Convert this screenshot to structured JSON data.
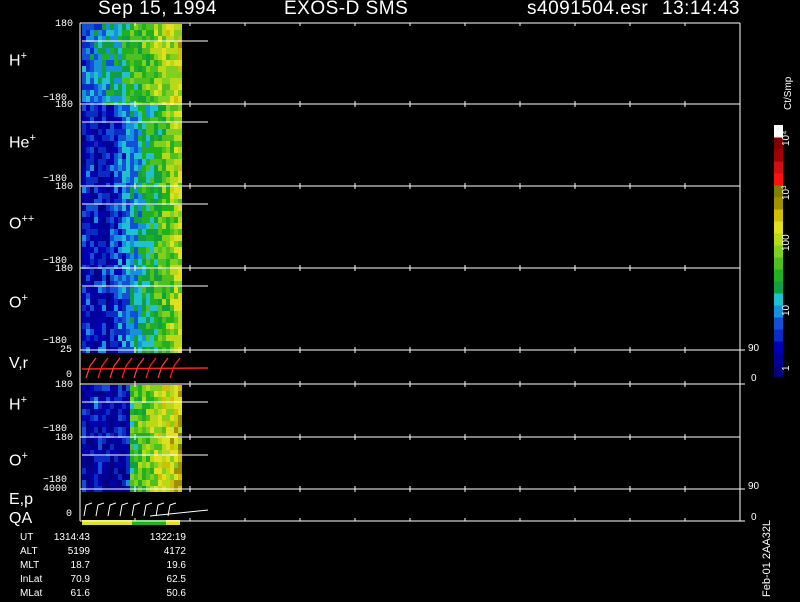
{
  "header": {
    "date": "Sep 15, 1994",
    "mission": "EXOS-D SMS",
    "file": "s4091504.esr",
    "time": "13:14:43"
  },
  "colorbar": {
    "unit": "Ct/Smp",
    "tick_labels": [
      "1",
      "10",
      "100",
      "10³",
      "10⁴"
    ],
    "colors": [
      "#000080",
      "#000099",
      "#0000b3",
      "#0a2bc4",
      "#1450d6",
      "#1890e0",
      "#20c0d0",
      "#10a040",
      "#20b020",
      "#50c020",
      "#80d020",
      "#b8d818",
      "#e0e020",
      "#d0c000",
      "#a09000",
      "#808000",
      "#ff1010",
      "#d01010",
      "#a00000",
      "#800000",
      "#ffffff"
    ]
  },
  "panels": [
    {
      "id": "h_plus_1",
      "label": "H",
      "sup": "+",
      "ymax": "180",
      "ymin": "−180"
    },
    {
      "id": "he_plus",
      "label": "He",
      "sup": "+",
      "ymax": "180",
      "ymin": "−180"
    },
    {
      "id": "o_plusplus",
      "label": "O",
      "sup": "++",
      "ymax": "180",
      "ymin": "−180"
    },
    {
      "id": "o_plus_1",
      "label": "O",
      "sup": "+",
      "ymax": "180",
      "ymin": "−180"
    },
    {
      "id": "v_r",
      "label": "V,r",
      "sup": "",
      "ymax": "25",
      "ymin": "0",
      "rmax": "90",
      "rmin": "0"
    },
    {
      "id": "h_plus_2",
      "label": "H",
      "sup": "+",
      "ymax": "180",
      "ymin": "−180"
    },
    {
      "id": "o_plus_2",
      "label": "O",
      "sup": "+",
      "ymax": "180",
      "ymin": "−180"
    },
    {
      "id": "ep_qa",
      "label": "E,p",
      "label2": "QA",
      "sup": "",
      "ymax": "4000",
      "ymin": "0",
      "rmax": "90",
      "rmin": "0"
    }
  ],
  "ephemeris": {
    "rows": [
      {
        "key": "UT",
        "v1": "1314:43",
        "v2": "1322:19"
      },
      {
        "key": "ALT",
        "v1": "5199",
        "v2": "4172"
      },
      {
        "key": "MLT",
        "v1": "18.7",
        "v2": "19.6"
      },
      {
        "key": "InLat",
        "v1": "70.9",
        "v2": "62.5"
      },
      {
        "key": "MLat",
        "v1": "61.6",
        "v2": "50.6"
      }
    ]
  },
  "stamp": "Feb-01 2AA32L",
  "chart_data": {
    "type": "heatmap",
    "title": "Sep 15, 1994   EXOS-D SMS",
    "x_range_ut": [
      "1314:43",
      "1322:19"
    ],
    "panels_y_range": {
      "ion_pitch_angle": [
        -180,
        180
      ],
      "V": [
        0,
        25
      ],
      "r": [
        0,
        90
      ],
      "E": [
        0,
        4000
      ],
      "p": [
        0,
        90
      ]
    },
    "color_scale": {
      "type": "log",
      "range": [
        1,
        10000
      ],
      "unit": "Ct/Smp"
    }
  }
}
